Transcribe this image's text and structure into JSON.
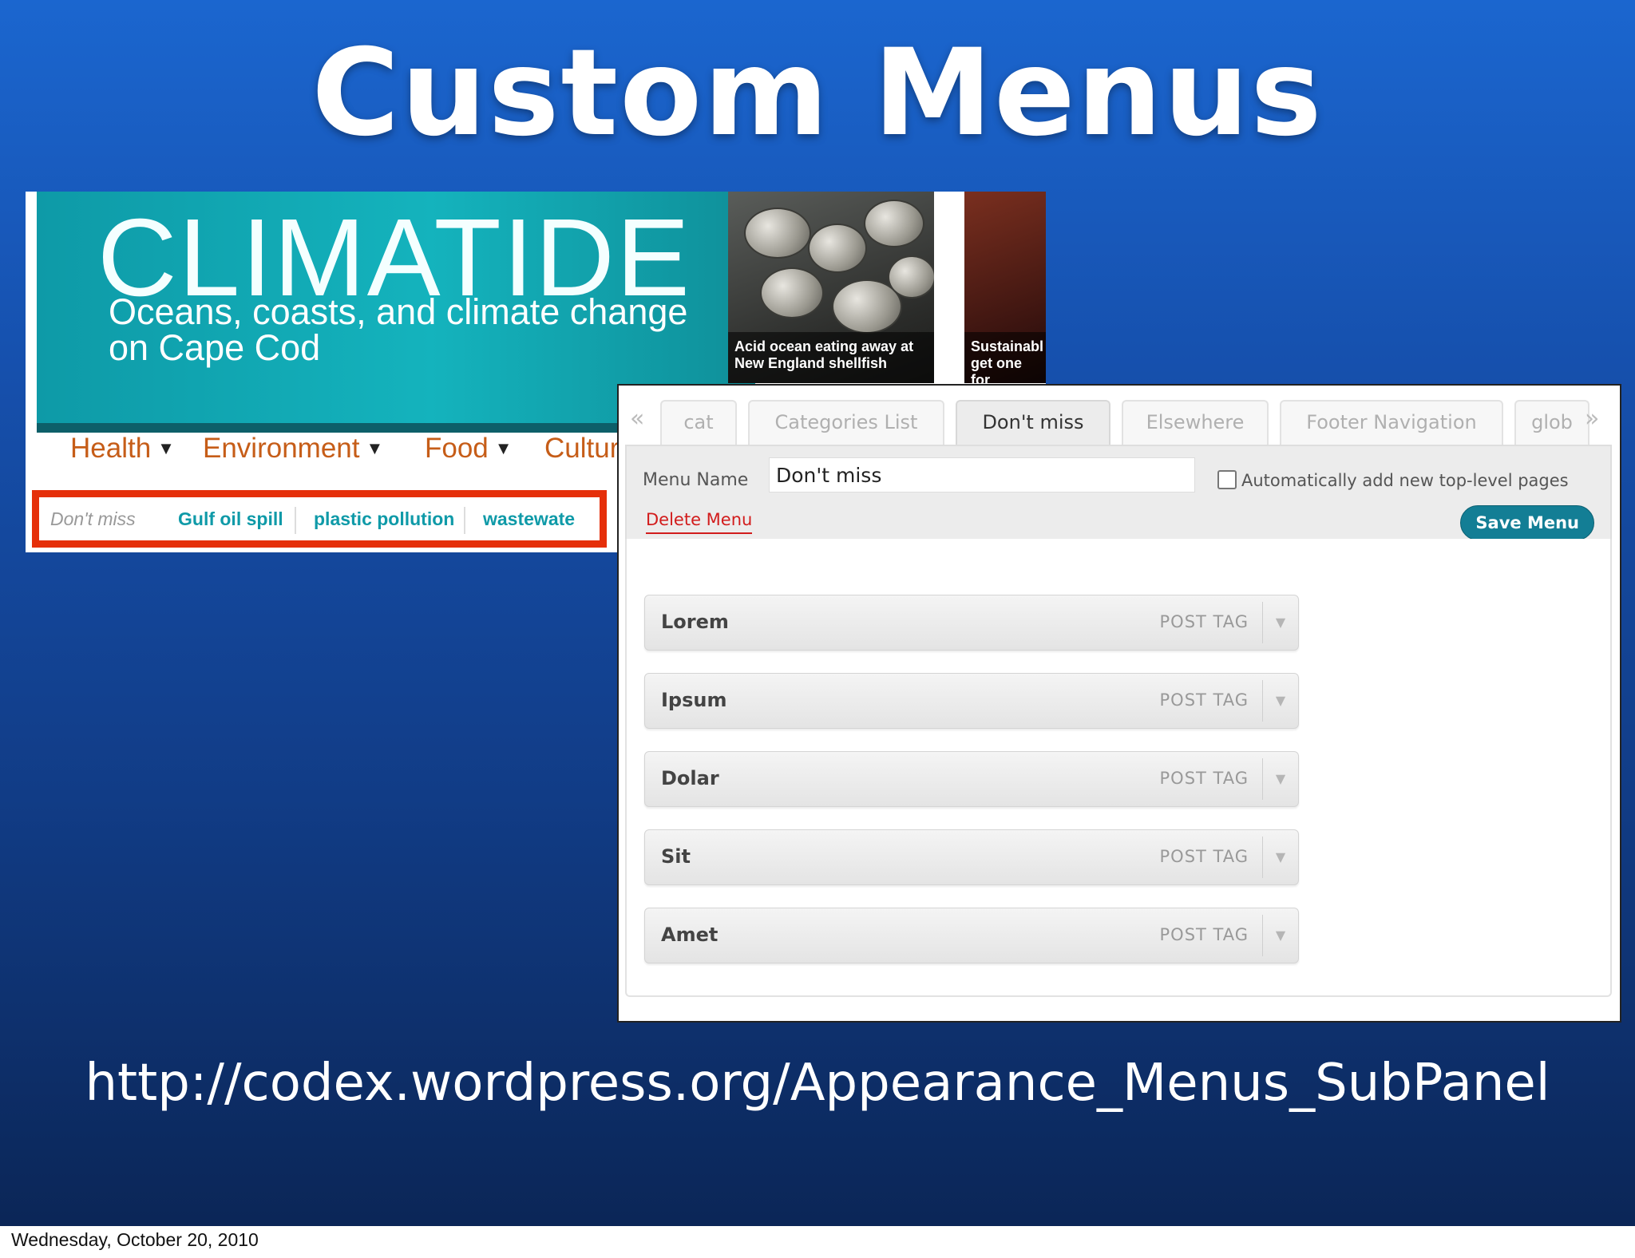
{
  "slide": {
    "title": "Custom Menus",
    "url": "http://codex.wordpress.org/Appearance_Menus_SubPanel",
    "date": "Wednesday, October 20, 2010"
  },
  "site": {
    "logo": "CLIMATIDE",
    "tagline": "Oceans, coasts, and climate change on Cape Cod",
    "thumbs": [
      {
        "caption": "Acid ocean eating away at New England shellfish"
      },
      {
        "caption": "Sustainabl get one for"
      }
    ],
    "nav": [
      "Health",
      "Environment",
      "Food",
      "Culture"
    ],
    "nav_caret": "▼",
    "subnav": {
      "label": "Don't miss",
      "items": [
        "Gulf oil spill",
        "plastic pollution",
        "wastewate"
      ]
    }
  },
  "wp": {
    "arrow_left": "«",
    "arrow_right": "»",
    "tabs": [
      "cat",
      "Categories List",
      "Don't miss",
      "Elsewhere",
      "Footer Navigation",
      "glob"
    ],
    "active_tab": "Don't miss",
    "menu_name_label": "Menu Name",
    "menu_name_value": "Don't miss",
    "auto_add_label": "Automatically add new top-level pages",
    "auto_add_checked": false,
    "delete_label": "Delete Menu",
    "save_label": "Save Menu",
    "toggle_glyph": "▼",
    "items": [
      {
        "title": "Lorem",
        "type": "POST TAG"
      },
      {
        "title": "Ipsum",
        "type": "POST TAG"
      },
      {
        "title": "Dolar",
        "type": "POST TAG"
      },
      {
        "title": "Sit",
        "type": "POST TAG"
      },
      {
        "title": "Amet",
        "type": "POST TAG"
      }
    ]
  },
  "colors": {
    "slide_bg_top": "#1b66cf",
    "slide_bg_bottom": "#0b2657",
    "site_teal": "#0f9aa8",
    "nav_orange": "#c65d18",
    "highlight_red": "#e52f0a",
    "save_button": "#137e95",
    "delete_red": "#d21c1c"
  }
}
